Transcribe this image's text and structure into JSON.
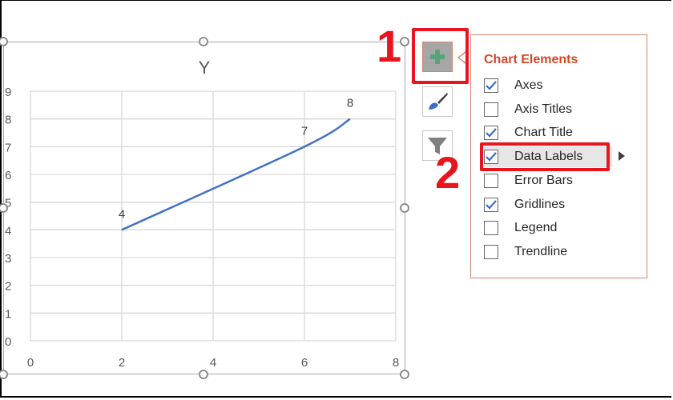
{
  "chart_data": {
    "type": "scatter",
    "subtype": "smooth-line",
    "title": "Y",
    "xlabel": "",
    "ylabel": "",
    "xlim": [
      0,
      8
    ],
    "ylim": [
      0,
      9
    ],
    "x_ticks": [
      "0",
      "2",
      "4",
      "6",
      "8"
    ],
    "y_ticks": [
      "0",
      "1",
      "2",
      "3",
      "4",
      "5",
      "6",
      "7",
      "8",
      "9"
    ],
    "grid": true,
    "legend": "none",
    "series": [
      {
        "name": "Y",
        "x": [
          2,
          6,
          7
        ],
        "y": [
          4,
          7,
          8
        ],
        "data_labels": [
          "4",
          "7",
          "8"
        ],
        "color": "#4472c4"
      }
    ]
  },
  "side_buttons": {
    "chart_elements": {
      "label": "Chart Elements",
      "icon": "plus-icon"
    },
    "chart_styles": {
      "label": "Chart Styles",
      "icon": "paintbrush-icon"
    },
    "chart_filters": {
      "label": "Chart Filters",
      "icon": "filter-icon"
    }
  },
  "annotations": {
    "step1": "1",
    "step2": "2",
    "color": "#e8151f"
  },
  "panel": {
    "title": "Chart Elements",
    "title_color": "#d24726",
    "items": [
      {
        "label": "Axes",
        "checked": true
      },
      {
        "label": "Axis Titles",
        "checked": false
      },
      {
        "label": "Chart Title",
        "checked": true
      },
      {
        "label": "Data Labels",
        "checked": true,
        "highlighted": true,
        "has_submenu": true
      },
      {
        "label": "Error Bars",
        "checked": false
      },
      {
        "label": "Gridlines",
        "checked": true
      },
      {
        "label": "Legend",
        "checked": false
      },
      {
        "label": "Trendline",
        "checked": false
      }
    ]
  }
}
